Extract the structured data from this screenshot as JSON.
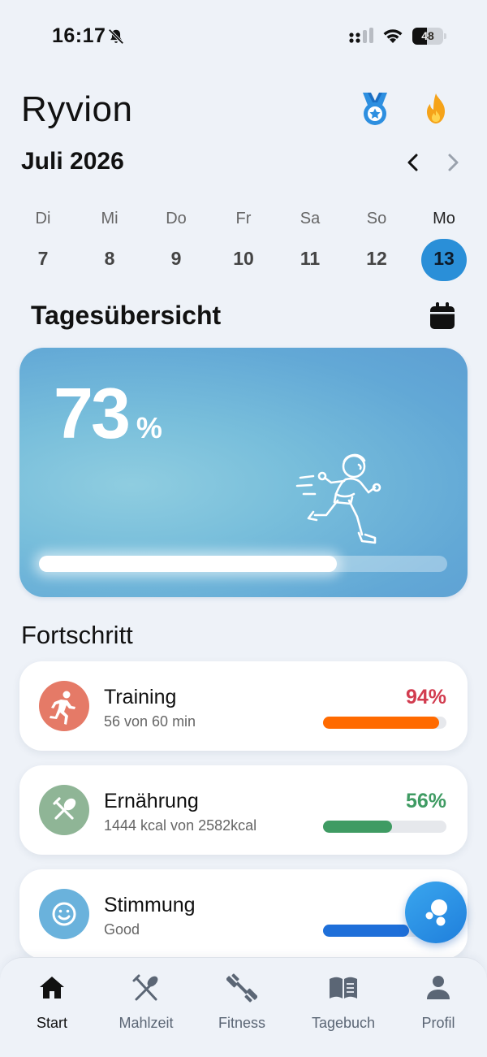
{
  "status_bar": {
    "time": "16:17",
    "battery": "48",
    "battery_level": 0.48
  },
  "header": {
    "app_title": "Ryvion",
    "month": "Juli 2026"
  },
  "week": [
    {
      "name": "Di",
      "num": "7"
    },
    {
      "name": "Mi",
      "num": "8"
    },
    {
      "name": "Do",
      "num": "9"
    },
    {
      "name": "Fr",
      "num": "10"
    },
    {
      "name": "Sa",
      "num": "11"
    },
    {
      "name": "So",
      "num": "12"
    },
    {
      "name": "Mo",
      "num": "13",
      "selected": true
    }
  ],
  "overview": {
    "title": "Tagesübersicht",
    "percent": "73",
    "unit": "%",
    "progress": 0.73
  },
  "progress_section": {
    "title": "Fortschritt",
    "items": [
      {
        "title": "Training",
        "subtitle": "56 von 60 min",
        "percent": "94%",
        "progress": 0.94,
        "pct_color": "#d23c4f",
        "bar_color": "#ff6a00",
        "icon_color": "#e57a67",
        "icon": "running-icon"
      },
      {
        "title": "Ernährung",
        "subtitle": "1444 kcal von 2582kcal",
        "percent": "56%",
        "progress": 0.56,
        "pct_color": "#3f9b63",
        "bar_color": "#3f9b63",
        "icon_color": "#8fb596",
        "icon": "utensils-icon"
      },
      {
        "title": "Stimmung",
        "subtitle": "Good",
        "percent": "",
        "progress": 0.7,
        "pct_color": "#1e6fd9",
        "bar_color": "#1e6fd9",
        "icon_color": "#6ab2dc",
        "icon": "smiley-icon"
      }
    ]
  },
  "bottom_nav": [
    {
      "label": "Start",
      "icon": "home-icon",
      "active": true
    },
    {
      "label": "Mahlzeit",
      "icon": "utensils-icon"
    },
    {
      "label": "Fitness",
      "icon": "dumbbell-icon"
    },
    {
      "label": "Tagebuch",
      "icon": "book-icon"
    },
    {
      "label": "Profil",
      "icon": "person-icon"
    }
  ],
  "colors": {
    "accent": "#2a8fd8",
    "background": "#eef2f8",
    "streak": "#f5a31a",
    "medal": "#2d8fe0"
  }
}
